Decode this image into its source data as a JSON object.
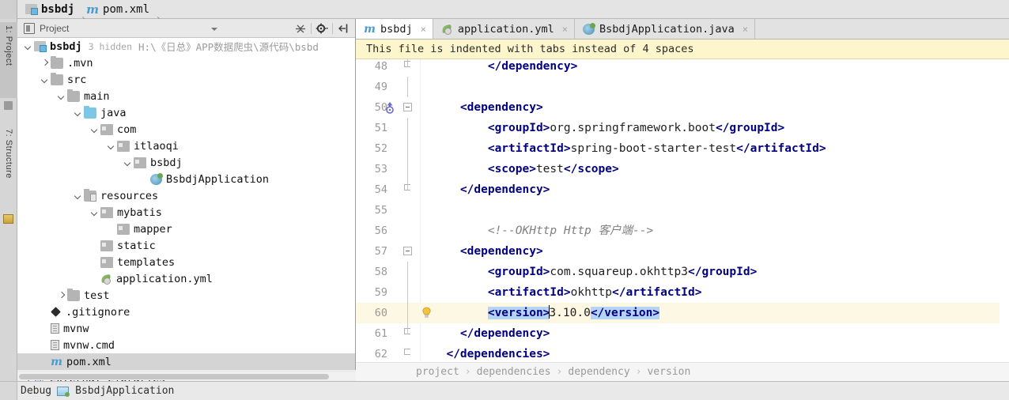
{
  "navbar": {
    "crumbs": [
      {
        "label": "bsbdj",
        "icon": "project-module-icon"
      },
      {
        "label": "pom.xml",
        "icon": "maven-file-icon"
      }
    ]
  },
  "left_rail": {
    "tabs": [
      {
        "label": "1: Project",
        "icon": "project-tool-icon"
      },
      {
        "label": "7: Structure",
        "icon": "structure-tool-icon"
      }
    ]
  },
  "project_panel": {
    "title": "Project",
    "toolbar": [
      {
        "name": "collapse-all-button",
        "icon": "collapse-all-icon"
      },
      {
        "name": "settings-button",
        "icon": "gear-icon"
      },
      {
        "name": "hide-button",
        "icon": "hide-panel-icon"
      }
    ],
    "tree": [
      {
        "indent": 0,
        "arrow": "down",
        "icon": "project-module-icon",
        "label": "bsbdj",
        "bold": true,
        "meta": "3 hidden",
        "path": "H:\\《日总》APP数据爬虫\\源代码\\bsbd"
      },
      {
        "indent": 1,
        "arrow": "right",
        "icon": "folder-gray-icon",
        "label": ".mvn"
      },
      {
        "indent": 1,
        "arrow": "down",
        "icon": "folder-gray-icon",
        "label": "src"
      },
      {
        "indent": 2,
        "arrow": "down",
        "icon": "folder-gray-icon",
        "label": "main"
      },
      {
        "indent": 3,
        "arrow": "down",
        "icon": "folder-source-icon",
        "label": "java"
      },
      {
        "indent": 4,
        "arrow": "down",
        "icon": "package-icon",
        "label": "com"
      },
      {
        "indent": 5,
        "arrow": "down",
        "icon": "package-icon",
        "label": "itlaoqi"
      },
      {
        "indent": 6,
        "arrow": "down",
        "icon": "package-icon",
        "label": "bsbdj"
      },
      {
        "indent": 7,
        "arrow": "none",
        "icon": "spring-class-icon",
        "label": "BsbdjApplication"
      },
      {
        "indent": 3,
        "arrow": "down",
        "icon": "folder-resources-icon",
        "label": "resources"
      },
      {
        "indent": 4,
        "arrow": "down",
        "icon": "package-icon",
        "label": "mybatis"
      },
      {
        "indent": 5,
        "arrow": "none",
        "icon": "package-icon",
        "label": "mapper"
      },
      {
        "indent": 4,
        "arrow": "none",
        "icon": "package-icon",
        "label": "static"
      },
      {
        "indent": 4,
        "arrow": "none",
        "icon": "package-icon",
        "label": "templates"
      },
      {
        "indent": 4,
        "arrow": "none",
        "icon": "yml-file-icon",
        "label": "application.yml"
      },
      {
        "indent": 2,
        "arrow": "right",
        "icon": "folder-gray-icon",
        "label": "test"
      },
      {
        "indent": 1,
        "arrow": "none",
        "icon": "gitignore-icon",
        "label": ".gitignore"
      },
      {
        "indent": 1,
        "arrow": "none",
        "icon": "text-file-icon",
        "label": "mvnw"
      },
      {
        "indent": 1,
        "arrow": "none",
        "icon": "text-file-icon",
        "label": "mvnw.cmd"
      },
      {
        "indent": 1,
        "arrow": "none",
        "icon": "maven-file-icon",
        "label": "pom.xml",
        "selected": true
      },
      {
        "indent": 0,
        "arrow": "right",
        "icon": "external-libraries-icon",
        "label": "External Libraries",
        "wide_row": true
      }
    ]
  },
  "editor": {
    "tabs": [
      {
        "label": "bsbdj",
        "icon": "maven-file-icon",
        "active": true,
        "close": "×"
      },
      {
        "label": "application.yml",
        "icon": "yml-file-icon",
        "active": false,
        "close": "×"
      },
      {
        "label": "BsbdjApplication.java",
        "icon": "spring-class-icon",
        "active": false,
        "close": "×"
      }
    ],
    "notification": "This file is indented with tabs instead of 4 spaces",
    "lines": [
      {
        "no": "48",
        "fold": "end",
        "gutter": "",
        "clipped_top": true,
        "segments": [
          {
            "t": "        ",
            "c": "txt"
          },
          {
            "t": "</dependency>",
            "c": "tagn"
          }
        ]
      },
      {
        "no": "49",
        "fold": "stem",
        "gutter": "",
        "segments": []
      },
      {
        "no": "50",
        "fold": "start",
        "gutter": "run-arrow-icon",
        "segments": [
          {
            "t": "    ",
            "c": "txt"
          },
          {
            "t": "<dependency>",
            "c": "tagn"
          }
        ]
      },
      {
        "no": "51",
        "fold": "stem",
        "gutter": "",
        "segments": [
          {
            "t": "        ",
            "c": "txt"
          },
          {
            "t": "<groupId>",
            "c": "tagn"
          },
          {
            "t": "org.springframework.boot",
            "c": "txt"
          },
          {
            "t": "</groupId>",
            "c": "tagn"
          }
        ]
      },
      {
        "no": "52",
        "fold": "stem",
        "gutter": "",
        "segments": [
          {
            "t": "        ",
            "c": "txt"
          },
          {
            "t": "<artifactId>",
            "c": "tagn"
          },
          {
            "t": "spring-boot-starter-test",
            "c": "txt"
          },
          {
            "t": "</artifactId>",
            "c": "tagn"
          }
        ]
      },
      {
        "no": "53",
        "fold": "stem",
        "gutter": "",
        "segments": [
          {
            "t": "        ",
            "c": "txt"
          },
          {
            "t": "<scope>",
            "c": "tagn"
          },
          {
            "t": "test",
            "c": "txt"
          },
          {
            "t": "</scope>",
            "c": "tagn"
          }
        ]
      },
      {
        "no": "54",
        "fold": "end",
        "gutter": "",
        "segments": [
          {
            "t": "    ",
            "c": "txt"
          },
          {
            "t": "</dependency>",
            "c": "tagn"
          }
        ]
      },
      {
        "no": "55",
        "fold": "",
        "gutter": "",
        "segments": []
      },
      {
        "no": "56",
        "fold": "",
        "gutter": "",
        "segments": [
          {
            "t": "        ",
            "c": "txt"
          },
          {
            "t": "<!--OKHttp Http 客户端-->",
            "c": "cmt"
          }
        ]
      },
      {
        "no": "57",
        "fold": "start",
        "gutter": "",
        "segments": [
          {
            "t": "    ",
            "c": "txt"
          },
          {
            "t": "<dependency>",
            "c": "tagn"
          }
        ]
      },
      {
        "no": "58",
        "fold": "stem",
        "gutter": "",
        "segments": [
          {
            "t": "        ",
            "c": "txt"
          },
          {
            "t": "<groupId>",
            "c": "tagn"
          },
          {
            "t": "com.squareup.okhttp3",
            "c": "txt"
          },
          {
            "t": "</groupId>",
            "c": "tagn"
          }
        ]
      },
      {
        "no": "59",
        "fold": "stem",
        "gutter": "",
        "segments": [
          {
            "t": "        ",
            "c": "txt"
          },
          {
            "t": "<artifactId>",
            "c": "tagn"
          },
          {
            "t": "okhttp",
            "c": "txt"
          },
          {
            "t": "</artifactId>",
            "c": "tagn"
          }
        ]
      },
      {
        "no": "60",
        "fold": "stem",
        "gutter": "lightbulb-icon",
        "highlight": true,
        "caret_after": 1,
        "segments": [
          {
            "t": "        ",
            "c": "txt"
          },
          {
            "t": "<version>",
            "c": "tagb"
          },
          {
            "t": "3.10.0",
            "c": "txt"
          },
          {
            "t": "</version>",
            "c": "tagb"
          }
        ]
      },
      {
        "no": "61",
        "fold": "end",
        "gutter": "",
        "segments": [
          {
            "t": "    ",
            "c": "txt"
          },
          {
            "t": "</dependency>",
            "c": "tagn"
          }
        ]
      },
      {
        "no": "62",
        "fold": "end2",
        "gutter": "",
        "segments": [
          {
            "t": "  ",
            "c": "txt"
          },
          {
            "t": "</dependencies>",
            "c": "tagn"
          }
        ]
      }
    ],
    "breadcrumb": [
      "project",
      "dependencies",
      "dependency",
      "version"
    ],
    "breadcrumb_separator": "›"
  },
  "statusbar": {
    "debug_label": "Debug",
    "config_name": "BsbdjApplication",
    "config_icon": "run-configuration-icon"
  },
  "colors": {
    "tag": "#000080",
    "tag_highlight": "#b3d4f5",
    "notification_bg": "#fdf6cd",
    "line_highlight": "#fcf8e4",
    "comment": "#808080",
    "selection": "#d4d4d4"
  }
}
